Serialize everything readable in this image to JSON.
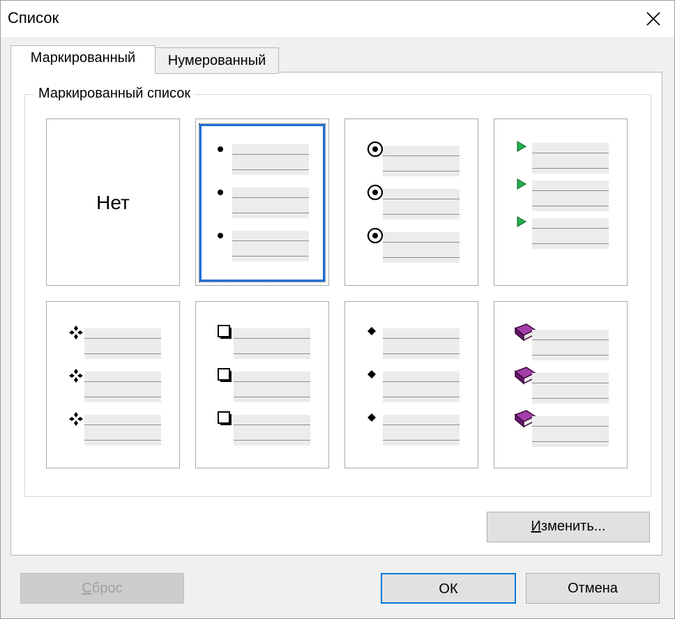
{
  "window": {
    "title": "Список"
  },
  "tabs": [
    {
      "label": "Маркированный",
      "active": true
    },
    {
      "label": "Нумерованный",
      "active": false
    }
  ],
  "group": {
    "label": "Маркированный список"
  },
  "styles": [
    {
      "id": "none",
      "label": "Нет",
      "bullet_icon": "none",
      "selected": false
    },
    {
      "id": "dot",
      "bullet_icon": "bullet-dot-icon",
      "selected": true
    },
    {
      "id": "circle-dot",
      "bullet_icon": "circled-dot-icon",
      "selected": false
    },
    {
      "id": "arrow",
      "bullet_icon": "green-arrow-icon",
      "color": "#22b14c",
      "selected": false
    },
    {
      "id": "clover",
      "bullet_icon": "four-diamond-icon",
      "selected": false
    },
    {
      "id": "box",
      "bullet_icon": "shadow-box-icon",
      "selected": false
    },
    {
      "id": "diamond",
      "bullet_icon": "small-diamond-icon",
      "selected": false
    },
    {
      "id": "book",
      "bullet_icon": "purple-book-icon",
      "color": "#7b1f7e",
      "selected": false
    }
  ],
  "buttons": {
    "change": {
      "prefix": "И",
      "rest": "зменить..."
    },
    "reset": {
      "prefix": "С",
      "rest": "брос",
      "disabled": true
    },
    "ok": "ОК",
    "cancel": "Отмена"
  },
  "colors": {
    "accent": "#0078d7",
    "selection_border": "#1e6fd6"
  }
}
